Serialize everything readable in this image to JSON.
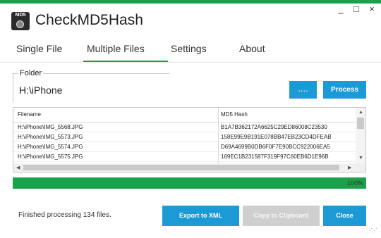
{
  "colors": {
    "accent_green": "#1aa24a",
    "button_blue": "#1c9ad6",
    "button_disabled": "#cfcfcf"
  },
  "app": {
    "logo_text": "MD5",
    "title": "CheckMD5Hash"
  },
  "window_controls": {
    "minimize": "_",
    "maximize": "□",
    "close": "×"
  },
  "tabs": [
    {
      "label": "Single File",
      "active": false
    },
    {
      "label": "Multiple Files",
      "active": true
    },
    {
      "label": "Settings",
      "active": false
    },
    {
      "label": "About",
      "active": false
    }
  ],
  "folder": {
    "label": "Folder",
    "value": "H:\\iPhone",
    "browse_label": "....",
    "process_label": "Process"
  },
  "grid": {
    "columns": [
      "Filename",
      "MD5 Hash"
    ],
    "rows": [
      {
        "filename": "H:\\iPhone\\IMG_5568.JPG",
        "hash": "B1A7B362172A6625C29ED86008C23530"
      },
      {
        "filename": "H:\\iPhone\\IMG_5573.JPG",
        "hash": "158E99E9B191E078BB47EB23CD4DFEAB"
      },
      {
        "filename": "H:\\iPhone\\IMG_5574.JPG",
        "hash": "D69A4699B0DB6F0F7E90BCC922006EA5"
      },
      {
        "filename": "H:\\iPhone\\IMG_5575.JPG",
        "hash": "169EC1B231587F319F97C60EB6D1E96B"
      }
    ]
  },
  "progress": {
    "percent": 100,
    "label": "100%"
  },
  "status": {
    "text": "Finished processing 134 files."
  },
  "actions": {
    "export_label": "Export to XML",
    "copy_label": "Copy to Clipboard",
    "close_label": "Close"
  }
}
